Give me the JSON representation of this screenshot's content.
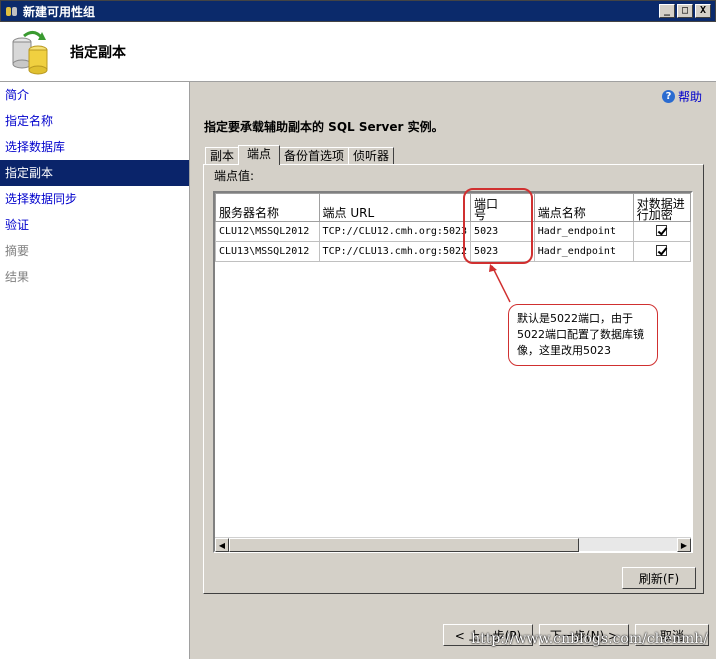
{
  "window": {
    "title": "新建可用性组",
    "minimize": "_",
    "maximize": "□",
    "close": "X"
  },
  "header": {
    "title": "指定副本"
  },
  "nav": {
    "items": [
      {
        "label": "简介"
      },
      {
        "label": "指定名称"
      },
      {
        "label": "选择数据库"
      },
      {
        "label": "指定副本"
      },
      {
        "label": "选择数据同步"
      },
      {
        "label": "验证"
      },
      {
        "label": "摘要"
      },
      {
        "label": "结果"
      }
    ]
  },
  "main": {
    "help": "帮助",
    "instruction": "指定要承载辅助副本的 SQL Server 实例。",
    "tabs": [
      "副本",
      "端点",
      "备份首选项",
      "侦听器"
    ],
    "endpoint_label": "端点值:",
    "columns": [
      "服务器名称",
      "端点 URL",
      "端口\n号",
      "端点名称",
      "对数据进\n行加密"
    ],
    "rows": [
      {
        "server": "CLU12\\MSSQL2012",
        "url": "TCP://CLU12.cmh.org:5023",
        "port": "5023",
        "name": "Hadr_endpoint",
        "encrypt": true
      },
      {
        "server": "CLU13\\MSSQL2012",
        "url": "TCP://CLU13.cmh.org:5022",
        "port": "5023",
        "name": "Hadr_endpoint",
        "encrypt": true
      }
    ],
    "refresh": "刷新(F)"
  },
  "callout": {
    "text": "默认是5022端口，由于5022端口配置了数据库镜像，这里改用5023"
  },
  "footer": {
    "prev": "< 上一步(P)",
    "next": "下一步(N) >",
    "cancel": "取消"
  },
  "watermark": "http://www.cnblogs.com/chenmh/"
}
